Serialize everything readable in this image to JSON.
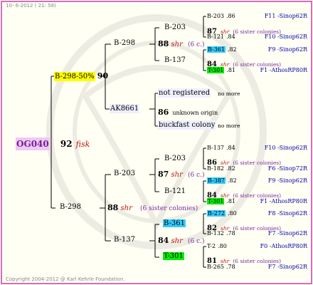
{
  "header": {
    "date": "10-  6-2012 ( 21: 58)"
  },
  "footer": {
    "copyright": "Copyright 2004-2012 @ Karl Kehrle Foundation."
  },
  "root": {
    "id": "OG040",
    "num": "92",
    "tag": "fisk"
  },
  "g1": {
    "upper": {
      "label": "B-298-50%",
      "num": "90"
    },
    "lower": {
      "label": "B-298",
      "num": "88",
      "tag": "shr",
      "note": "(6 sister colonies)"
    }
  },
  "g2": {
    "a": {
      "label": "B-298",
      "num": "88",
      "tag": "shr",
      "note": "(6 c.)"
    },
    "b": {
      "label": "AK8661"
    },
    "c": {
      "label": "B-203",
      "num": "87",
      "tag": "shr",
      "note": "(6 c.)"
    },
    "d": {
      "label": "B-137",
      "num": "84",
      "tag": "shr",
      "note": "(6 c.)"
    }
  },
  "g3": {
    "a1": {
      "label": "B-203",
      "num": "87",
      "tag": "shr",
      "note": "(6 sister colonies)"
    },
    "a2": {
      "label": "B-137",
      "num": "84",
      "tag": "shr",
      "note": "(6 sister colonies)"
    },
    "b1": {
      "label": "not registered",
      "extra": "no more"
    },
    "b2": {
      "num": "86",
      "extra": "unknown origin"
    },
    "b3": {
      "label": "buckfast colony",
      "extra": "no more"
    },
    "c1": {
      "label": "B-203",
      "num": "86",
      "tag": "shr",
      "note": "(6 sister colonies)"
    },
    "c2": {
      "label": "B-121",
      "num": "84",
      "tag": "shr",
      "note": "(6 sister colonies)"
    },
    "d1": {
      "label": "B-361",
      "num": "82",
      "tag": "shr",
      "note": "(6 sister colonies)"
    },
    "d2": {
      "label": "T-301",
      "num": "81",
      "tag": "shr",
      "note": "(6 sister colonies)"
    }
  },
  "g4": [
    {
      "label": "B-203",
      "num": ".86",
      "breeder": "F11 -Sinop62R"
    },
    {
      "label": "B-121",
      "num": ".84",
      "breeder": "F10 -Sinop62R"
    },
    {
      "label": "B-361",
      "num": ".82",
      "breeder": "F9 -Sinop62R"
    },
    {
      "label": "T-301",
      "num": ".81",
      "breeder": "F1 -AthosRP80R"
    },
    {
      "label": "B-137",
      "num": ".84",
      "breeder": "F10 -Sinop62R"
    },
    {
      "label": "B-182",
      "num": ".82",
      "breeder": "F6 -Sinop72R"
    },
    {
      "label": "B-387",
      "num": ".82",
      "breeder": "F9 -Sinop62R"
    },
    {
      "label": "T-301",
      "num": ".81",
      "breeder": "F1 -AthosRP80R"
    },
    {
      "label": "B-272",
      "num": ".80",
      "breeder": "F8 -Sinop62R"
    },
    {
      "label": "B-132",
      "num": ".78",
      "breeder": "F7 -Sinop62R"
    },
    {
      "label": "T-2",
      "num": ".80",
      "breeder": "F0 -AthosRP80R"
    },
    {
      "label": "B-265",
      "num": ".78",
      "breeder": "F7 -Sinop62R"
    }
  ]
}
